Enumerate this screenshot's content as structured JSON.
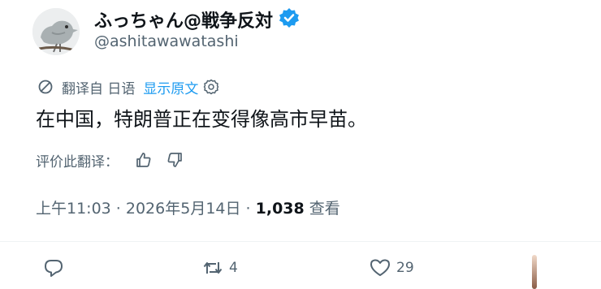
{
  "author": {
    "display_name": "ふっちゃん@戦争反対",
    "handle": "@ashitawawatashi",
    "avatar_icon": "bird-avatar-icon",
    "verified_icon": "verified-badge-icon"
  },
  "translation": {
    "label": "翻译自 日语",
    "show_original": "显示原文"
  },
  "tweet": {
    "text": "在中国，特朗普正在变得像高市早苗。"
  },
  "rating": {
    "label": "评价此翻译："
  },
  "meta": {
    "time": "上午11:03 · 2026年5月14日 · ",
    "views_count": "1,038",
    "views_label": " 查看"
  },
  "actions": {
    "reply_count": "",
    "retweet_count": "4",
    "like_count": "29"
  },
  "colors": {
    "accent": "#1d9bf0",
    "secondary_text": "#536471",
    "primary_text": "#0f1419"
  }
}
